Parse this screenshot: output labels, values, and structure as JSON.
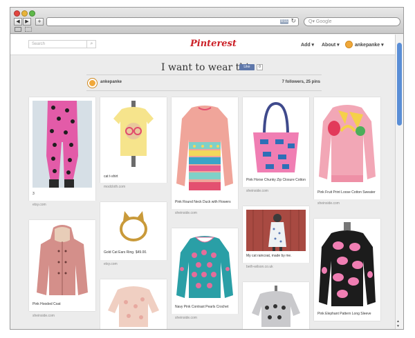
{
  "browser": {
    "back_label": "◀",
    "forward_label": "▶",
    "new_tab_label": "+",
    "rss_label": "RSS",
    "reload_label": "↻",
    "search_placeholder": "Q▾ Google"
  },
  "header": {
    "search_placeholder": "Search",
    "logo": "Pinterest",
    "add_label": "Add ▾",
    "about_label": "About ▾",
    "user_label": "ankepanke ▾"
  },
  "board": {
    "title": "I want to wear this",
    "like_label": "Like",
    "like_count": "0",
    "owner": "ankepanke",
    "stats": "7 followers, 25 pins"
  },
  "pins": [
    {
      "desc": "3",
      "source": "etsy.com",
      "img": "cat-print-leggings"
    },
    {
      "desc": "Pink Hooded Coat",
      "source": "sheinside.com",
      "img": "pink-hooded-coat"
    },
    {
      "desc": "cat t-shirt",
      "source": "modcloth.com",
      "img": "cat-glasses-tshirt"
    },
    {
      "desc": "Gold Cat Ears Ring. $49.00.",
      "source": "etsy.com",
      "img": "cat-ears-ring"
    },
    {
      "desc": "",
      "source": "",
      "img": "pastel-knit-sweater"
    },
    {
      "desc": "Pink Round Neck Duck with Flowers",
      "source": "sheinside.com",
      "img": "duck-sweater"
    },
    {
      "desc": "Navy Pink Contrast Pearls Crochet",
      "source": "sheinside.com",
      "img": "polka-dot-sweater"
    },
    {
      "desc": "Pink Horse Chunky Zip Closure Cotton",
      "source": "sheinside.com",
      "img": "horse-tote-bag"
    },
    {
      "desc": "My cat raincoat, made by me.",
      "source": "beth-wilson.co.uk",
      "img": "cat-raincoat-photo"
    },
    {
      "desc": "",
      "source": "",
      "img": "grey-cat-sweater"
    },
    {
      "desc": "Pink Fruit Print Loose Cotton Sweater",
      "source": "sheinside.com",
      "img": "fruit-sweater"
    },
    {
      "desc": "Pink Elephant Pattern Long Sleeve",
      "source": "",
      "img": "elephant-sweater"
    }
  ]
}
